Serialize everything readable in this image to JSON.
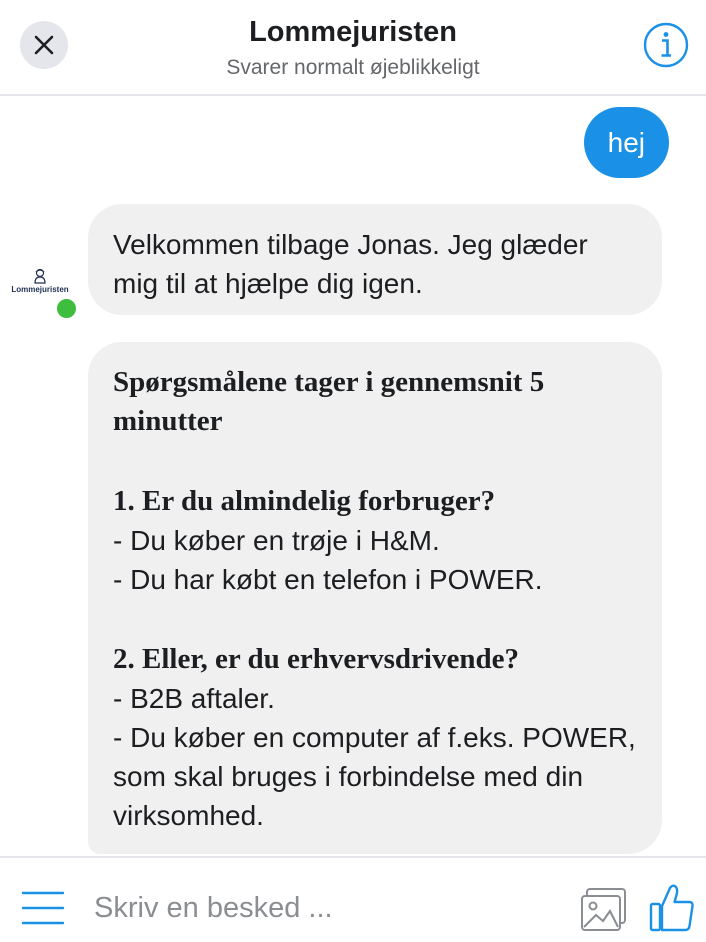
{
  "header": {
    "title": "Lommejuristen",
    "status": "Svarer normalt øjeblikkeligt"
  },
  "messages": {
    "outgoing": [
      "hej"
    ],
    "avatar_label": "Lommejuristen",
    "incoming": {
      "welcome": "Velkommen tilbage Jonas. Jeg glæder mig til at hjælpe dig igen.",
      "intro": "Spørgsmålene tager i gennemsnit 5 minutter",
      "q1_heading": "1. Er du almindelig forbruger?",
      "q1_lines": [
        "- Du køber en trøje i H&M.",
        "- Du har købt en telefon i POWER."
      ],
      "q2_heading": "2. Eller, er du erhvervsdrivende?",
      "q2_lines": [
        "- B2B aftaler.",
        "- Du køber en computer af f.eks. POWER, som skal bruges i forbindelse med din virksomhed."
      ]
    }
  },
  "composer": {
    "placeholder": "Skriv en besked ..."
  },
  "icons": {
    "close": "close-icon",
    "info": "info-icon",
    "menu": "menu-icon",
    "image": "image-icon",
    "like": "thumbs-up-icon"
  },
  "colors": {
    "accent": "#1a91e6",
    "online": "#3ebd3e",
    "bubble_in": "#f0f0f0"
  }
}
